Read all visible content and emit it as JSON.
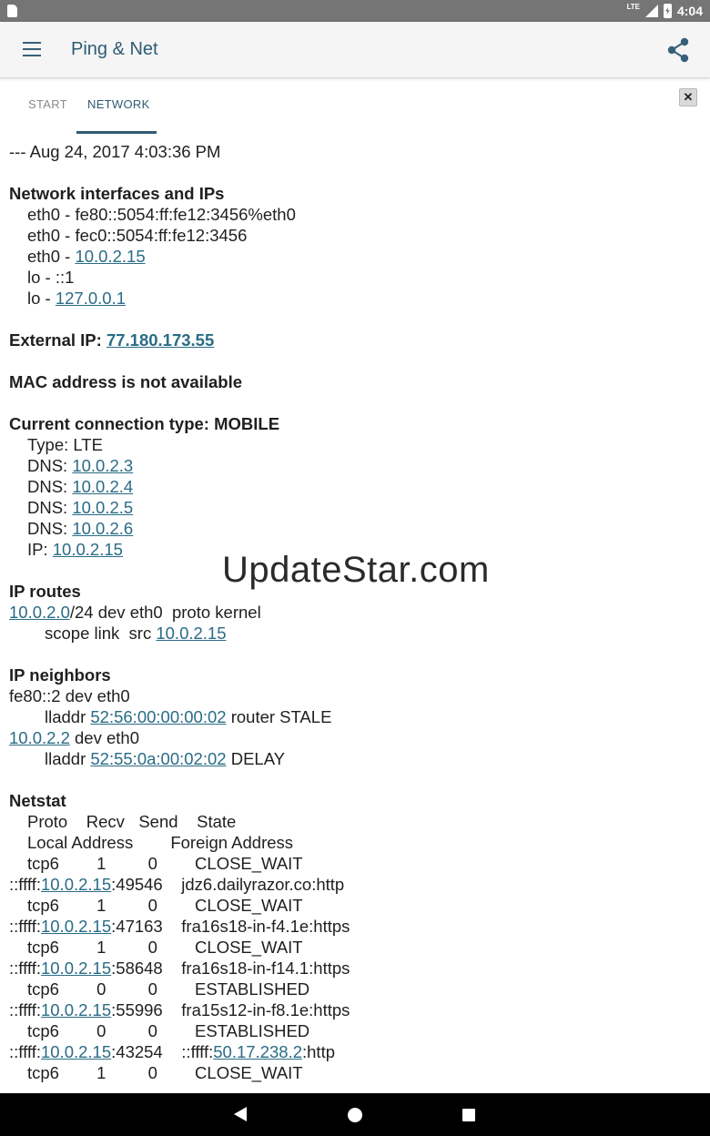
{
  "status_bar": {
    "network": "LTE",
    "time": "4:04"
  },
  "app_bar": {
    "title": "Ping & Net"
  },
  "tabs": [
    {
      "label": "START"
    },
    {
      "label": "NETWORK"
    }
  ],
  "close_label": "✕",
  "colors": {
    "accent": "#2e5c74",
    "link": "#2a6c86"
  },
  "watermark": "UpdateStar.com",
  "report_lines": [
    {
      "indent": 0,
      "bold": false,
      "parts": [
        {
          "t": "--- Aug 24, 2017 4:03:36 PM"
        }
      ]
    },
    null,
    {
      "indent": 0,
      "bold": true,
      "parts": [
        {
          "t": "Network interfaces and IPs"
        }
      ]
    },
    {
      "indent": 1,
      "bold": false,
      "parts": [
        {
          "t": "eth0 - fe80::5054:ff:fe12:3456%eth0"
        }
      ]
    },
    {
      "indent": 1,
      "bold": false,
      "parts": [
        {
          "t": "eth0 - fec0::5054:ff:fe12:3456"
        }
      ]
    },
    {
      "indent": 1,
      "bold": false,
      "parts": [
        {
          "t": "eth0 - "
        },
        {
          "t": "10.0.2.15",
          "link": true
        }
      ]
    },
    {
      "indent": 1,
      "bold": false,
      "parts": [
        {
          "t": "lo - ::1"
        }
      ]
    },
    {
      "indent": 1,
      "bold": false,
      "parts": [
        {
          "t": "lo - "
        },
        {
          "t": "127.0.0.1",
          "link": true
        }
      ]
    },
    null,
    {
      "indent": 0,
      "bold": true,
      "parts": [
        {
          "t": "External IP: "
        },
        {
          "t": "77.180.173.55",
          "link": true
        }
      ]
    },
    null,
    {
      "indent": 0,
      "bold": true,
      "parts": [
        {
          "t": "MAC address is not available"
        }
      ]
    },
    null,
    {
      "indent": 0,
      "bold": true,
      "parts": [
        {
          "t": "Current connection type: MOBILE"
        }
      ]
    },
    {
      "indent": 1,
      "bold": false,
      "parts": [
        {
          "t": "Type: LTE"
        }
      ]
    },
    {
      "indent": 1,
      "bold": false,
      "parts": [
        {
          "t": "DNS: "
        },
        {
          "t": "10.0.2.3",
          "link": true
        }
      ]
    },
    {
      "indent": 1,
      "bold": false,
      "parts": [
        {
          "t": "DNS: "
        },
        {
          "t": "10.0.2.4",
          "link": true
        }
      ]
    },
    {
      "indent": 1,
      "bold": false,
      "parts": [
        {
          "t": "DNS: "
        },
        {
          "t": "10.0.2.5",
          "link": true
        }
      ]
    },
    {
      "indent": 1,
      "bold": false,
      "parts": [
        {
          "t": "DNS: "
        },
        {
          "t": "10.0.2.6",
          "link": true
        }
      ]
    },
    {
      "indent": 1,
      "bold": false,
      "parts": [
        {
          "t": "IP: "
        },
        {
          "t": "10.0.2.15",
          "link": true
        }
      ]
    },
    null,
    {
      "indent": 0,
      "bold": true,
      "parts": [
        {
          "t": "IP routes"
        }
      ]
    },
    {
      "indent": 0,
      "bold": false,
      "parts": [
        {
          "t": "10.0.2.0",
          "link": true
        },
        {
          "t": "/24 dev eth0  proto kernel"
        }
      ]
    },
    {
      "indent": 2,
      "bold": false,
      "parts": [
        {
          "t": "scope link  src "
        },
        {
          "t": "10.0.2.15",
          "link": true
        }
      ]
    },
    null,
    {
      "indent": 0,
      "bold": true,
      "parts": [
        {
          "t": "IP neighbors"
        }
      ]
    },
    {
      "indent": 0,
      "bold": false,
      "parts": [
        {
          "t": "fe80::2 dev eth0"
        }
      ]
    },
    {
      "indent": 2,
      "bold": false,
      "parts": [
        {
          "t": "lladdr "
        },
        {
          "t": "52:56:00:00:00:02",
          "link": true
        },
        {
          "t": " router STALE"
        }
      ]
    },
    {
      "indent": 0,
      "bold": false,
      "parts": [
        {
          "t": "10.0.2.2",
          "link": true
        },
        {
          "t": " dev eth0"
        }
      ]
    },
    {
      "indent": 2,
      "bold": false,
      "parts": [
        {
          "t": "lladdr "
        },
        {
          "t": "52:55:0a:00:02:02",
          "link": true
        },
        {
          "t": " DELAY"
        }
      ]
    },
    null,
    {
      "indent": 0,
      "bold": true,
      "parts": [
        {
          "t": "Netstat"
        }
      ]
    },
    {
      "indent": 1,
      "bold": false,
      "parts": [
        {
          "t": "Proto    Recv   Send    State"
        }
      ]
    },
    {
      "indent": 1,
      "bold": false,
      "parts": [
        {
          "t": "Local Address        Foreign Address"
        }
      ]
    },
    {
      "indent": 1,
      "bold": false,
      "parts": [
        {
          "t": "tcp6        1         0        CLOSE_WAIT"
        }
      ]
    },
    {
      "indent": 0,
      "bold": false,
      "parts": [
        {
          "t": "::ffff:"
        },
        {
          "t": "10.0.2.15",
          "link": true
        },
        {
          "t": ":49546    jdz6.dailyrazor.co:http"
        }
      ]
    },
    {
      "indent": 1,
      "bold": false,
      "parts": [
        {
          "t": "tcp6        1         0        CLOSE_WAIT"
        }
      ]
    },
    {
      "indent": 0,
      "bold": false,
      "parts": [
        {
          "t": "::ffff:"
        },
        {
          "t": "10.0.2.15",
          "link": true
        },
        {
          "t": ":47163    fra16s18-in-f4.1e:https"
        }
      ]
    },
    {
      "indent": 1,
      "bold": false,
      "parts": [
        {
          "t": "tcp6        1         0        CLOSE_WAIT"
        }
      ]
    },
    {
      "indent": 0,
      "bold": false,
      "parts": [
        {
          "t": "::ffff:"
        },
        {
          "t": "10.0.2.15",
          "link": true
        },
        {
          "t": ":58648    fra16s18-in-f14.1:https"
        }
      ]
    },
    {
      "indent": 1,
      "bold": false,
      "parts": [
        {
          "t": "tcp6        0         0        ESTABLISHED"
        }
      ]
    },
    {
      "indent": 0,
      "bold": false,
      "parts": [
        {
          "t": "::ffff:"
        },
        {
          "t": "10.0.2.15",
          "link": true
        },
        {
          "t": ":55996    fra15s12-in-f8.1e:https"
        }
      ]
    },
    {
      "indent": 1,
      "bold": false,
      "parts": [
        {
          "t": "tcp6        0         0        ESTABLISHED"
        }
      ]
    },
    {
      "indent": 0,
      "bold": false,
      "parts": [
        {
          "t": "::ffff:"
        },
        {
          "t": "10.0.2.15",
          "link": true
        },
        {
          "t": ":43254    ::ffff:"
        },
        {
          "t": "50.17.238.2",
          "link": true
        },
        {
          "t": ":http"
        }
      ]
    },
    {
      "indent": 1,
      "bold": false,
      "parts": [
        {
          "t": "tcp6        1         0        CLOSE_WAIT"
        }
      ]
    }
  ]
}
